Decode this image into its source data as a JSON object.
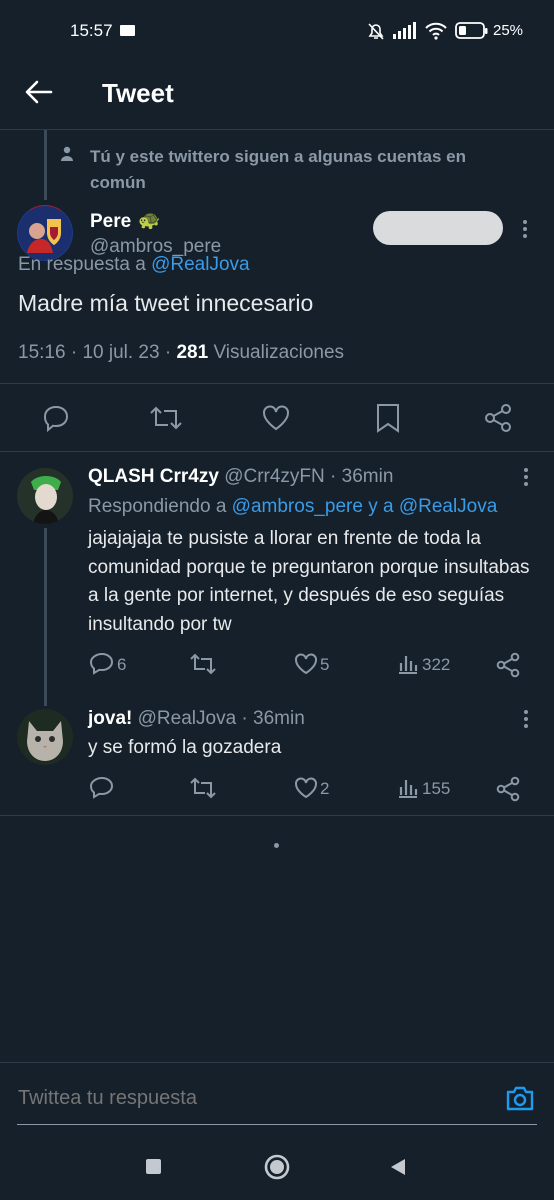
{
  "status_bar": {
    "time": "15:57",
    "battery": "25%"
  },
  "header": {
    "title": "Tweet"
  },
  "main_tweet": {
    "social_context": "Tú y este twittero siguen a algunas cuentas en común",
    "author_name": "Pere",
    "author_emoji": "🐢",
    "author_handle": "@ambros_pere",
    "reply_prefix": "En respuesta a",
    "reply_to": "@RealJova",
    "text": "Madre mía tweet innecesario",
    "time": "15:16",
    "date": "10 jul. 23",
    "separator": "·",
    "views_count": "281",
    "views_label": "Visualizaciones"
  },
  "replies": [
    {
      "name": "QLASH Crr4zy",
      "handle": "@Crr4zyFN",
      "time": "· 36min",
      "replying_prefix": "Respondiendo a",
      "replying_to": "@ambros_pere y a @RealJova",
      "text": "jajajajaja te pusiste a llorar en frente de toda la comunidad porque te preguntaron porque insultabas a la gente por internet, y después de eso seguías insultando por tw",
      "replies_count": "6",
      "retweets_count": "",
      "likes_count": "5",
      "views_count": "322"
    },
    {
      "name": "jova!",
      "handle": "@RealJova",
      "time": "· 36min",
      "text": "y se formó la gozadera",
      "replies_count": "",
      "retweets_count": "",
      "likes_count": "2",
      "views_count": "155"
    }
  ],
  "compose": {
    "placeholder": "Twittea tu respuesta"
  },
  "colors": {
    "background": "#15202b",
    "accent": "#1d9bf0",
    "muted": "#8b98a5"
  }
}
